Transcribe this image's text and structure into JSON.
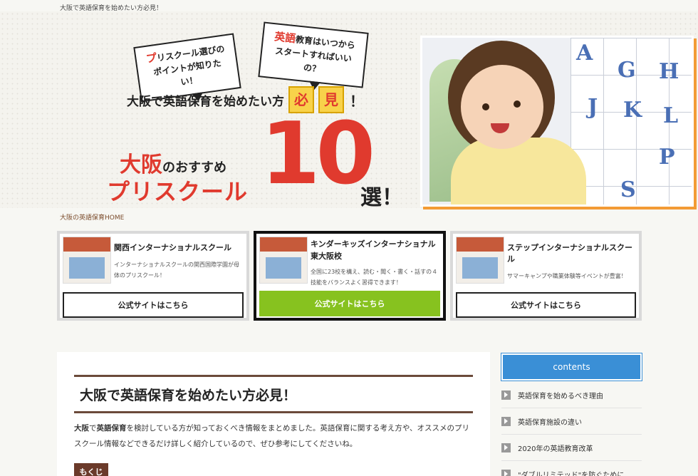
{
  "site": {
    "tagline": "大阪で英語保育を始めたい方必見！",
    "breadcrumb": "大阪の英語保育HOME"
  },
  "hero": {
    "bubble1_first": "プ",
    "bubble1_rest": "リスクール選びの\nポイントが知りたい！",
    "bubble2_first": "英語",
    "bubble2_rest": "教育はいつから\nスタートすればいいの？",
    "subtitle": "大阪で英語保育を始めたい方",
    "box1": "必",
    "box2": "見",
    "exclaim": "！",
    "city": "大阪",
    "city_suffix": "のおすすめ",
    "prefix": "プリスクール",
    "number": "10",
    "suffix": "選！",
    "photo_letters": [
      "A",
      "G",
      "H",
      "J",
      "K",
      "L",
      "P",
      "S"
    ]
  },
  "cards": [
    {
      "name": "関西インターナショナルスクール",
      "desc": "インターナショナルスクールの関西国際学園が母体のプリスクール！",
      "cta": "公式サイトはこちら"
    },
    {
      "name": "キンダーキッズインターナショナル東大阪校",
      "desc": "全国に23校を構え、読む・聞く・書く・話すの４技能をバランスよく習得できます！",
      "cta": "公式サイトはこちら"
    },
    {
      "name": "ステップインターナショナルスクール",
      "desc": "サマーキャンプや職業体験等イベントが豊富！",
      "cta": "公式サイトはこちら"
    }
  ],
  "article": {
    "title": "大阪で英語保育を始めたい方必見！",
    "intro_b1": "大阪",
    "intro_t1": "で",
    "intro_b2": "英語保育",
    "intro_t2": "を検討している方が知っておくべき情報をまとめました。英語保育に関する考え方や、オススメのプリスクール情報などできるだけ詳しく紹介しているので、ぜひ参考にしてくださいね。",
    "toc_label": "もくじ"
  },
  "sidebar": {
    "heading": "contents",
    "items": [
      "英語保育を始めるべき理由",
      "英語保育施設の違い",
      "2020年の英語教育改革",
      "\"ダブルリミテッド\"を防ぐために"
    ]
  },
  "colors": {
    "accent_red": "#e03a2e",
    "brand_brown": "#6b4a3a",
    "cta_green": "#87c21f",
    "sidebar_blue": "#3a8fd6"
  }
}
